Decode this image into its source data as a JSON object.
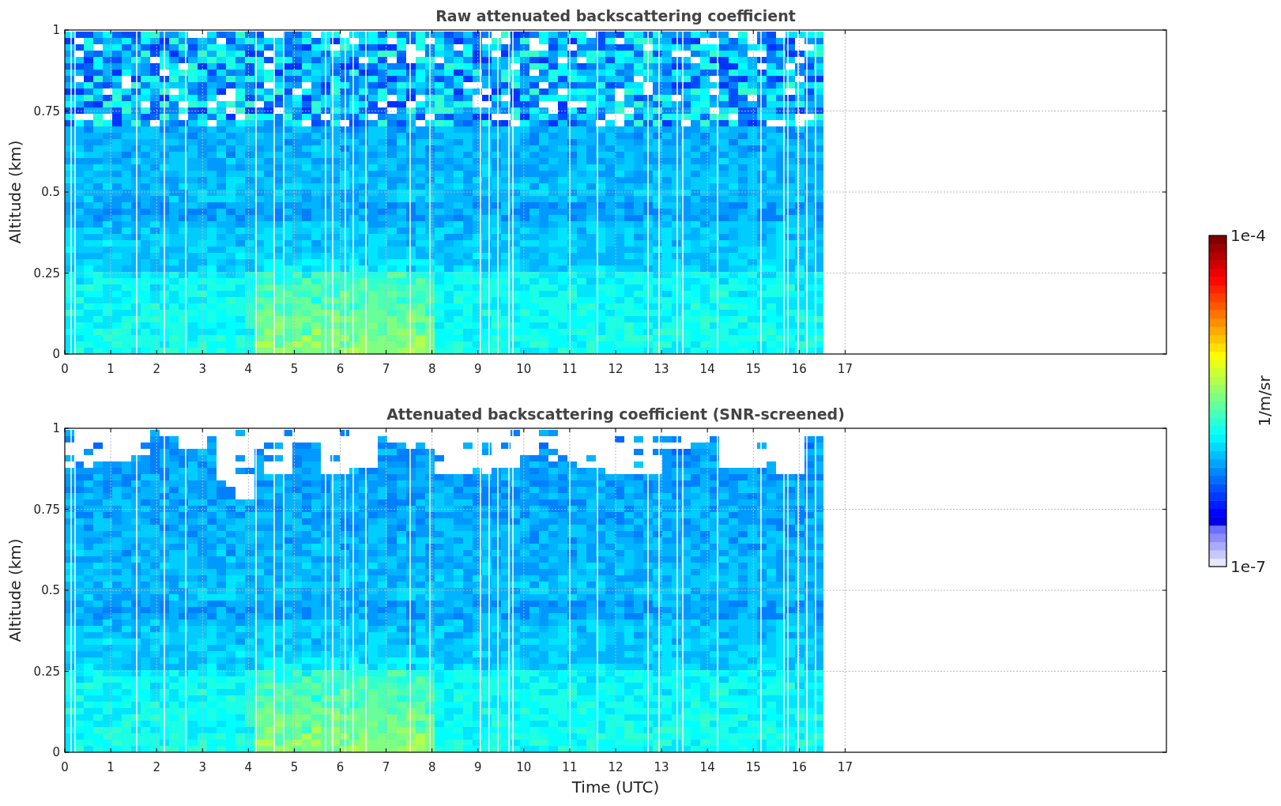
{
  "panels": [
    {
      "kind": "raw",
      "title": "Raw attenuated backscattering coefficient",
      "ylabel": "Altitude (km)",
      "yticks": [
        "1",
        "0.75",
        "0.5",
        "0.25",
        "0"
      ],
      "xticks": [
        "0",
        "1",
        "2",
        "3",
        "4",
        "5",
        "6",
        "7",
        "8",
        "9",
        "10",
        "11",
        "12",
        "13",
        "14",
        "15",
        "16",
        "17"
      ]
    },
    {
      "kind": "screened",
      "title": "Attenuated backscattering coefficient (SNR-screened)",
      "ylabel": "Altitude (km)",
      "yticks": [
        "1",
        "0.75",
        "0.5",
        "0.25",
        "0"
      ],
      "xticks": [
        "0",
        "1",
        "2",
        "3",
        "4",
        "5",
        "6",
        "7",
        "8",
        "9",
        "10",
        "11",
        "12",
        "13",
        "14",
        "15",
        "16",
        "17"
      ],
      "xlabel": "Time (UTC)"
    }
  ],
  "colorbar": {
    "label": "1/m/sr",
    "max_label": "1e-4",
    "min_label": "1e-7"
  }
}
